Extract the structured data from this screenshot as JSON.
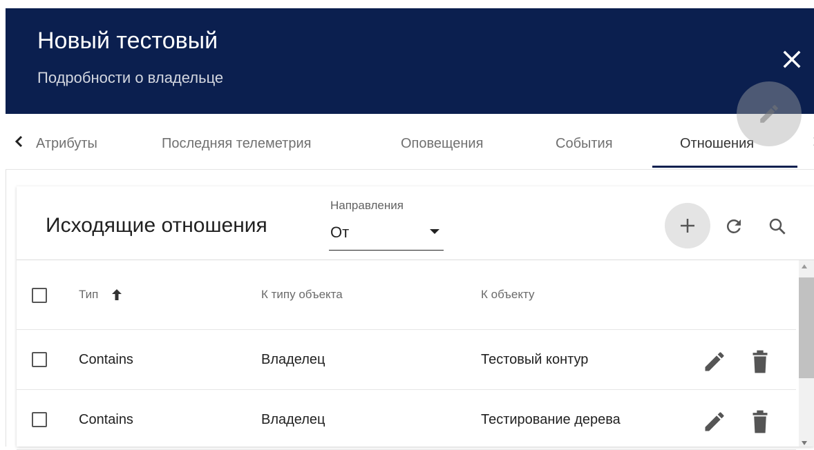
{
  "header": {
    "title": "Новый тестовый",
    "subtitle": "Подробности о владельце"
  },
  "tabs": {
    "items": [
      {
        "label": "Атрибуты",
        "active": false
      },
      {
        "label": "Последняя телеметрия",
        "active": false
      },
      {
        "label": "Оповещения",
        "active": false
      },
      {
        "label": "События",
        "active": false
      },
      {
        "label": "Отношения",
        "active": true
      }
    ]
  },
  "relations": {
    "title": "Исходящие отношения",
    "direction_label": "Направления",
    "direction_value": "От",
    "columns": {
      "type": "Тип",
      "to_entity_type": "К типу объекта",
      "to_entity": "К объекту"
    },
    "rows": [
      {
        "type": "Contains",
        "to_entity_type": "Владелец",
        "to_entity": "Тестовый контур"
      },
      {
        "type": "Contains",
        "to_entity_type": "Владелец",
        "to_entity": "Тестирование дерева"
      }
    ]
  },
  "colors": {
    "header_bg": "#0b1f4f",
    "ink_bar": "#0b1f4f",
    "add_button_bg": "#e4e4e4"
  },
  "icons": [
    "close-icon",
    "edit-icon",
    "chevron-left-icon",
    "chevron-right-icon",
    "add-icon",
    "refresh-icon",
    "search-icon",
    "sort-arrow-up-icon",
    "delete-icon"
  ]
}
